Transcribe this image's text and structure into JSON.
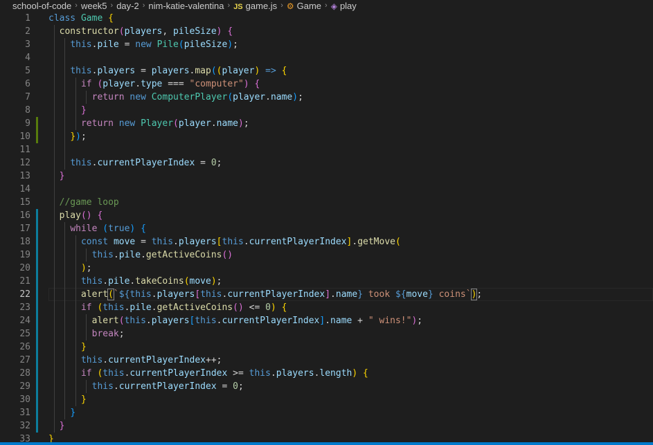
{
  "breadcrumb": {
    "items": [
      "school-of-code",
      "week5",
      "day-2",
      "nim-katie-valentina"
    ],
    "file_badge": "JS",
    "file": "game.js",
    "class_symbol": "Game",
    "method_symbol": "play",
    "separator": "›"
  },
  "editor": {
    "active_line": 22,
    "lines": [
      {
        "n": "1"
      },
      {
        "n": "2"
      },
      {
        "n": "3"
      },
      {
        "n": "4"
      },
      {
        "n": "5"
      },
      {
        "n": "6"
      },
      {
        "n": "7"
      },
      {
        "n": "8"
      },
      {
        "n": "9"
      },
      {
        "n": "10"
      },
      {
        "n": "11"
      },
      {
        "n": "12"
      },
      {
        "n": "13"
      },
      {
        "n": "14"
      },
      {
        "n": "15"
      },
      {
        "n": "16"
      },
      {
        "n": "17"
      },
      {
        "n": "18"
      },
      {
        "n": "19"
      },
      {
        "n": "20"
      },
      {
        "n": "21"
      },
      {
        "n": "22"
      },
      {
        "n": "23"
      },
      {
        "n": "24"
      },
      {
        "n": "25"
      },
      {
        "n": "26"
      },
      {
        "n": "27"
      },
      {
        "n": "28"
      },
      {
        "n": "29"
      },
      {
        "n": "30"
      },
      {
        "n": "31"
      },
      {
        "n": "32"
      },
      {
        "n": "33"
      }
    ],
    "tokens": {
      "class_kw": "class",
      "Game": "Game",
      "constructor": "constructor",
      "players": "players",
      "pileSize": "pileSize",
      "this": "this",
      "pile": "pile",
      "new": "new",
      "Pile": "Pile",
      "map": "map",
      "player": "player",
      "arrow": "=>",
      "if": "if",
      "type": "type",
      "str_computer": "\"computer\"",
      "return": "return",
      "ComputerPlayer": "ComputerPlayer",
      "name": "name",
      "Player": "Player",
      "currentPlayerIndex": "currentPlayerIndex",
      "zero": "0",
      "comment_game_loop": "//game loop",
      "play": "play",
      "while": "while",
      "true": "true",
      "const": "const",
      "move": "move",
      "getMove": "getMove",
      "getActiveCoins": "getActiveCoins",
      "takeCoins": "takeCoins",
      "alert": "alert",
      "tpl_took": " took ",
      "tpl_coins": " coins",
      "str_wins": "\" wins!\"",
      "break": "break",
      "length": "length"
    }
  },
  "colors": {
    "background": "#1e1e1e",
    "keyword": "#569cd6",
    "control": "#c586c0",
    "class_name": "#4ec9b0",
    "function": "#dcdcaa",
    "variable": "#9cdcfe",
    "string": "#ce9178",
    "number": "#b5cea8",
    "comment": "#6a9955",
    "status_bar": "#007acc"
  }
}
